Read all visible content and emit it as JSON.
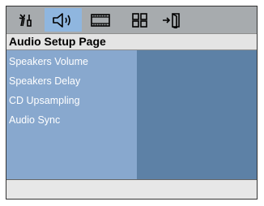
{
  "toolbar": {
    "icons": [
      "settings-icon",
      "speaker-icon",
      "display-icon",
      "preferences-icon",
      "exit-icon"
    ],
    "active": "speaker-icon"
  },
  "page": {
    "title": "Audio Setup Page"
  },
  "menu": {
    "items": [
      {
        "label": "Speakers Volume"
      },
      {
        "label": "Speakers Delay"
      },
      {
        "label": "CD Upsampling"
      },
      {
        "label": "Audio Sync"
      }
    ]
  },
  "colors": {
    "toolbar_bg": "#a7abae",
    "active_tab": "#8fb6df",
    "menu_panel": "#88a8ce",
    "value_panel": "#5d81a6",
    "footer_bg": "#e7e7e7"
  }
}
